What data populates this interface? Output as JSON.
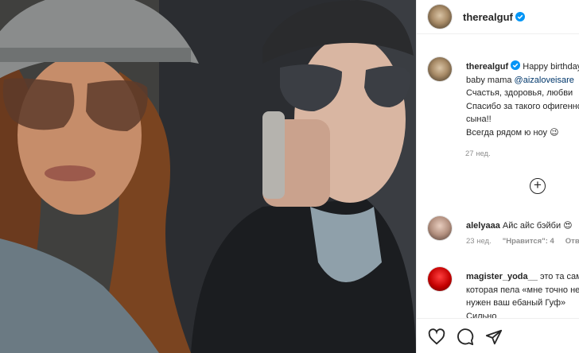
{
  "post": {
    "username": "therealguf",
    "caption_lines": [
      {
        "prefix": "therealguf",
        "text": " Happy birthday"
      },
      {
        "text": "baby mama ",
        "mention": "@aizaloveisare"
      },
      {
        "text": "Счастья, здоровья, любви"
      },
      {
        "text": "Спасибо за такого офигенного"
      },
      {
        "text": "сына!!"
      },
      {
        "text": "Всегда рядом ю ноу 😉"
      }
    ],
    "caption_time": "27 нед."
  },
  "comments": [
    {
      "username": "alelyaaa",
      "lines": [
        "Айс айс бэйби 😍"
      ],
      "time": "23 нед.",
      "likes": "\"Нравится\": 4",
      "reply": "Ответить"
    },
    {
      "username": "magister_yoda__",
      "lines": [
        "это та самая",
        "которая пела «мне точно не",
        "нужен ваш ебаный Гуф»",
        "Сильно"
      ]
    }
  ],
  "icons": {
    "verified": "verified-badge-icon",
    "more": "plus-circle-icon",
    "like": "heart-icon",
    "comment": "comment-icon",
    "share": "paper-plane-icon"
  },
  "colors": {
    "verified": "#0095f6",
    "mention": "#00376b",
    "muted": "#8e8e8e"
  }
}
